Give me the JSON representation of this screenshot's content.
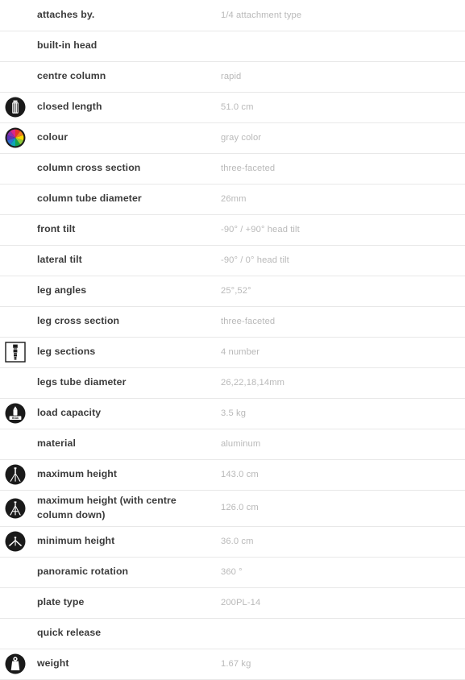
{
  "table": {
    "rows": [
      {
        "icon": "none",
        "label": "attaches by.",
        "value": "1/4 attachment type"
      },
      {
        "icon": "none",
        "label": "built-in head",
        "value": ""
      },
      {
        "icon": "none",
        "label": "centre column",
        "value": "rapid"
      },
      {
        "icon": "closed-length",
        "label": "closed length",
        "value": "51.0 cm"
      },
      {
        "icon": "colour-wheel",
        "label": "colour",
        "value": "gray color"
      },
      {
        "icon": "none",
        "label": "column cross section",
        "value": "three-faceted"
      },
      {
        "icon": "none",
        "label": "column tube diameter",
        "value": "26mm"
      },
      {
        "icon": "none",
        "label": "front tilt",
        "value": "-90° / +90° head tilt"
      },
      {
        "icon": "none",
        "label": "lateral tilt",
        "value": "-90° / 0° head tilt"
      },
      {
        "icon": "none",
        "label": "leg angles",
        "value": "25°,52°"
      },
      {
        "icon": "none",
        "label": "leg cross section",
        "value": "three-faceted"
      },
      {
        "icon": "leg-sections",
        "label": "leg sections",
        "value": "4 number"
      },
      {
        "icon": "none",
        "label": "legs tube diameter",
        "value": "26,22,18,14mm"
      },
      {
        "icon": "load-capacity",
        "label": "load capacity",
        "value": "3.5 kg"
      },
      {
        "icon": "none",
        "label": "material",
        "value": "aluminum"
      },
      {
        "icon": "tripod-max",
        "label": "maximum height",
        "value": "143.0 cm"
      },
      {
        "icon": "tripod-column",
        "label": "maximum height (with centre column down)",
        "value": "126.0 cm",
        "tall": true
      },
      {
        "icon": "tripod-min",
        "label": "minimum height",
        "value": "36.0 cm"
      },
      {
        "icon": "none",
        "label": "panoramic rotation",
        "value": "360 °"
      },
      {
        "icon": "none",
        "label": "plate type",
        "value": "200PL-14"
      },
      {
        "icon": "none",
        "label": "quick release",
        "value": ""
      },
      {
        "icon": "weight",
        "label": "weight",
        "value": "1.67 kg"
      }
    ]
  },
  "colors": {
    "label_text": "#3b3b3b",
    "value_text": "#b9b9b9",
    "row_divider": "#e8e8e8",
    "icon_fill": "#1a1a1a",
    "background": "#ffffff"
  }
}
